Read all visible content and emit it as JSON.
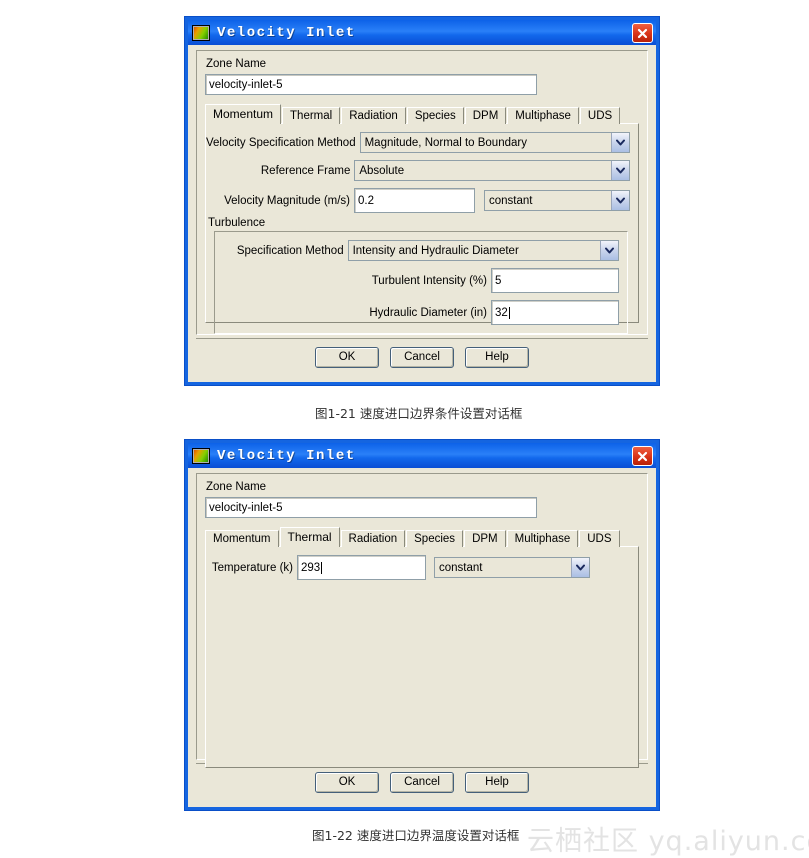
{
  "page": {
    "background": "#ffffff",
    "watermark": "云栖社区 yq.aliyun.com"
  },
  "theme": {
    "dialog_face": "#eae7d8",
    "title_blue": "#1268ec",
    "close_red": "#d83318",
    "field_white": "#ffffff"
  },
  "dialog1": {
    "title": "Velocity Inlet",
    "icon": "fluent-app-icon",
    "close_label": "×",
    "zone_name": {
      "label": "Zone Name",
      "value": "velocity-inlet-5"
    },
    "tabs": [
      {
        "label": "Momentum",
        "active": true
      },
      {
        "label": "Thermal",
        "active": false
      },
      {
        "label": "Radiation",
        "active": false
      },
      {
        "label": "Species",
        "active": false
      },
      {
        "label": "DPM",
        "active": false
      },
      {
        "label": "Multiphase",
        "active": false
      },
      {
        "label": "UDS",
        "active": false
      }
    ],
    "fields": {
      "velocity_spec_method": {
        "label": "Velocity Specification Method",
        "value": "Magnitude, Normal to Boundary"
      },
      "reference_frame": {
        "label": "Reference Frame",
        "value": "Absolute"
      },
      "velocity_magnitude": {
        "label": "Velocity Magnitude (m/s)",
        "value": "0.2",
        "profile": "constant"
      }
    },
    "turbulence": {
      "title": "Turbulence",
      "spec_method": {
        "label": "Specification Method",
        "value": "Intensity and Hydraulic Diameter"
      },
      "turbulent_intensity": {
        "label": "Turbulent Intensity (%)",
        "value": "5"
      },
      "hydraulic_diameter": {
        "label": "Hydraulic Diameter (in)",
        "value": "32"
      }
    },
    "buttons": {
      "ok": "OK",
      "cancel": "Cancel",
      "help": "Help"
    },
    "caption": "图1-21 速度进口边界条件设置对话框"
  },
  "dialog2": {
    "title": "Velocity Inlet",
    "icon": "fluent-app-icon",
    "close_label": "×",
    "zone_name": {
      "label": "Zone Name",
      "value": "velocity-inlet-5"
    },
    "tabs": [
      {
        "label": "Momentum",
        "active": false
      },
      {
        "label": "Thermal",
        "active": true
      },
      {
        "label": "Radiation",
        "active": false
      },
      {
        "label": "Species",
        "active": false
      },
      {
        "label": "DPM",
        "active": false
      },
      {
        "label": "Multiphase",
        "active": false
      },
      {
        "label": "UDS",
        "active": false
      }
    ],
    "fields": {
      "temperature": {
        "label": "Temperature (k)",
        "value": "293",
        "profile": "constant"
      }
    },
    "buttons": {
      "ok": "OK",
      "cancel": "Cancel",
      "help": "Help"
    },
    "caption": "图1-22 速度进口边界温度设置对话框"
  }
}
